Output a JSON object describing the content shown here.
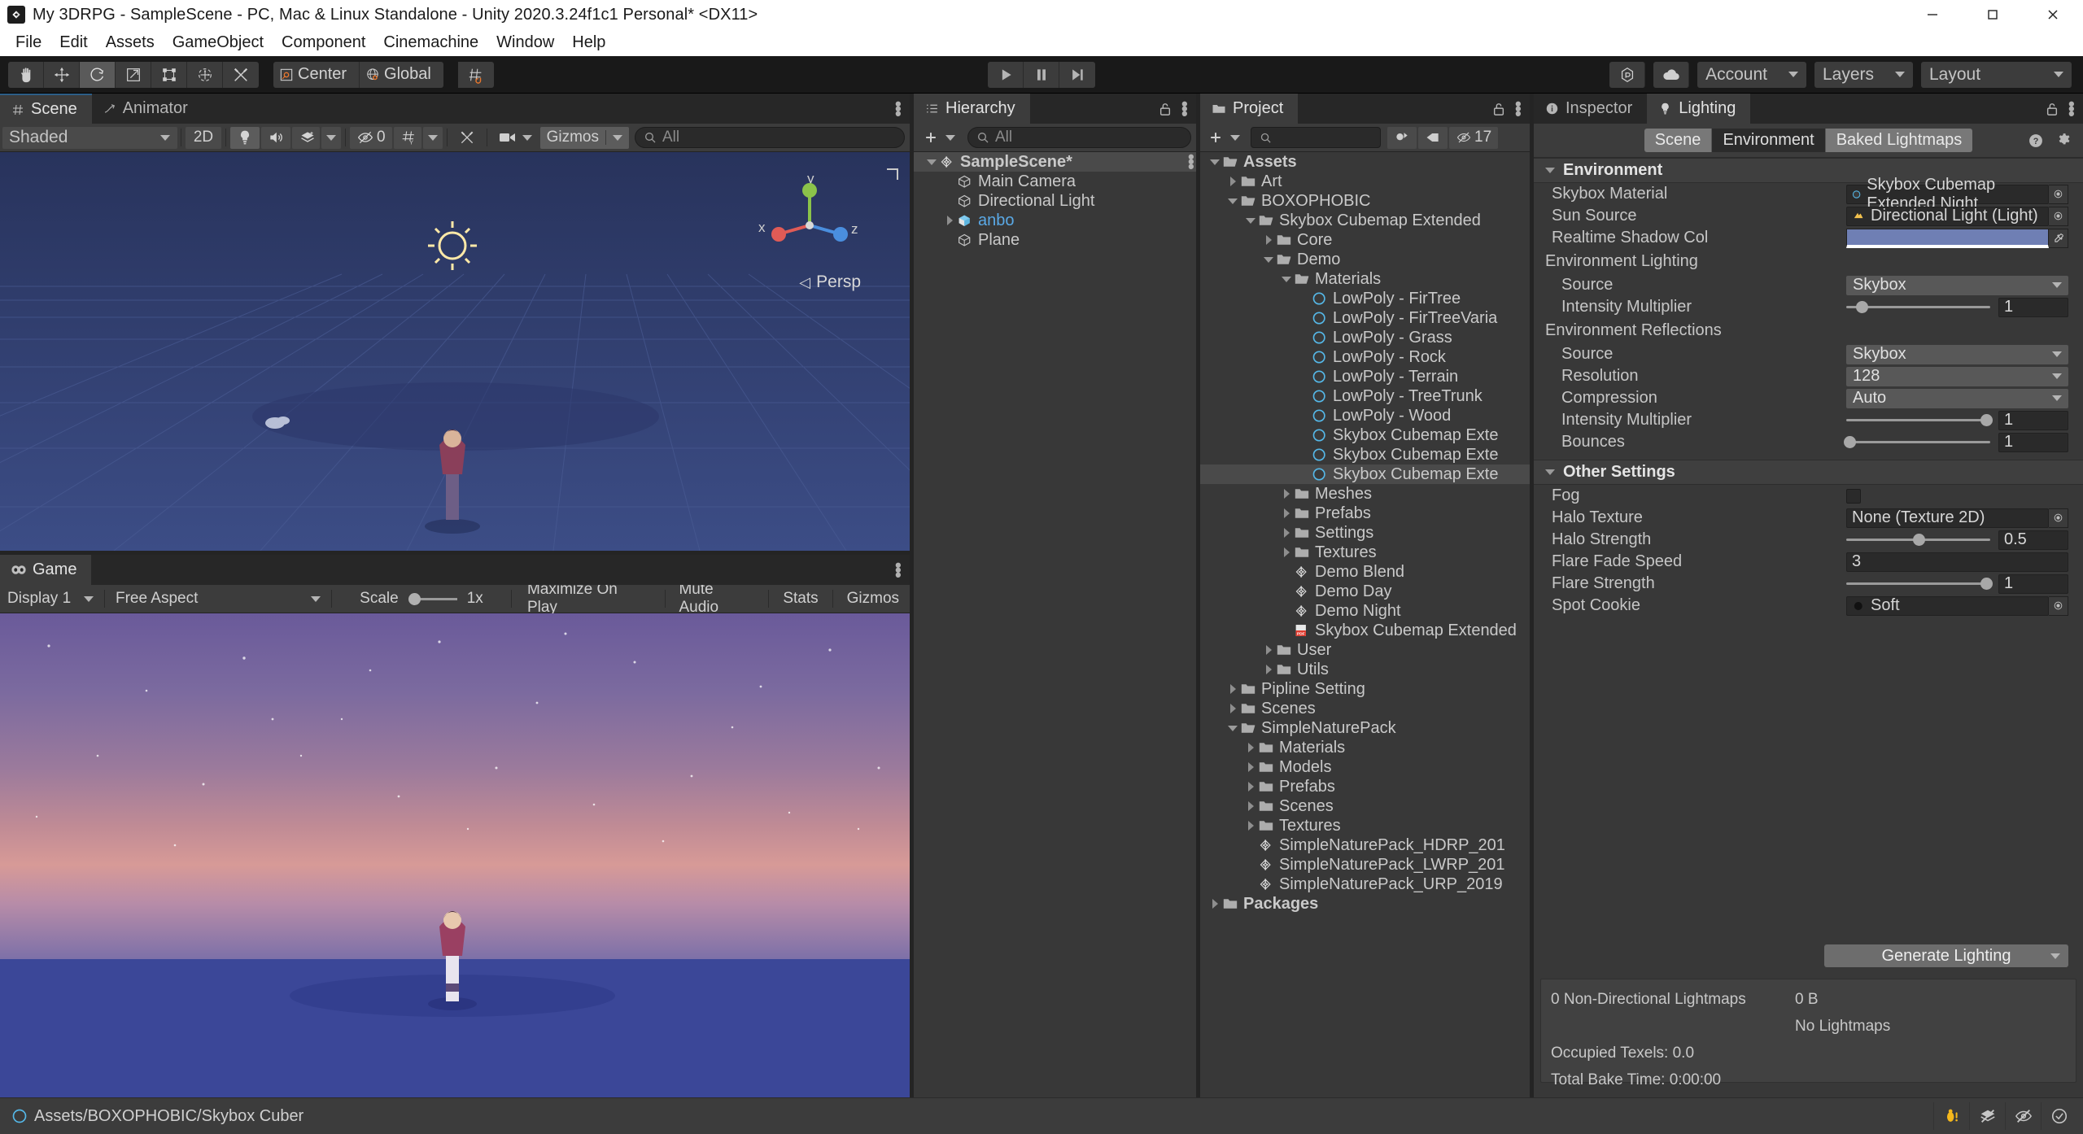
{
  "window": {
    "title": "My 3DRPG - SampleScene - PC, Mac & Linux Standalone - Unity 2020.3.24f1c1 Personal* <DX11>",
    "minimize": "minimize-icon",
    "maximize": "maximize-icon",
    "close": "close-icon"
  },
  "menubar": {
    "items": [
      "File",
      "Edit",
      "Assets",
      "GameObject",
      "Component",
      "Cinemachine",
      "Window",
      "Help"
    ]
  },
  "toolbar": {
    "tools": [
      "hand-tool",
      "move-tool",
      "rotate-tool",
      "scale-tool",
      "rect-tool",
      "transform-tool",
      "custom-tool"
    ],
    "active_tool": "rotate-tool",
    "pivot_mode": "Center",
    "handle_space": "Global",
    "grid_label": "grid-snapping",
    "play": "play-button",
    "pause": "pause-button",
    "step": "step-button",
    "collab": "collab-icon",
    "cloud": "cloud-icon",
    "account": "Account",
    "layers": "Layers",
    "layout": "Layout"
  },
  "scene_panel": {
    "tabs": [
      {
        "label": "Scene",
        "icon": "grid-icon",
        "active": true
      },
      {
        "label": "Animator",
        "icon": "animator-icon",
        "active": false
      }
    ],
    "shading": "Shaded",
    "mode_2d": "2D",
    "lighting_toggle": "scene-lighting-icon",
    "audio_toggle": "scene-audio-icon",
    "fx_toggle": "scene-fx-icon",
    "hidden_count": "0",
    "grid_visibility": "grid-visibility-icon",
    "component_tools": "scene-tools-icon",
    "camera_menu": "scene-camera-icon",
    "gizmos": "Gizmos",
    "search_placeholder": "All",
    "gizmo_axes": {
      "x": "x",
      "y": "y",
      "z": "z"
    },
    "projection": "Persp"
  },
  "game_panel": {
    "tab": "Game",
    "display": "Display 1",
    "aspect": "Free Aspect",
    "scale_label": "Scale",
    "scale_value": "1x",
    "maximize": "Maximize On Play",
    "mute": "Mute Audio",
    "stats": "Stats",
    "gizmos": "Gizmos"
  },
  "hierarchy": {
    "tab": "Hierarchy",
    "lock": "lock-icon",
    "menu": "kebab-menu-icon",
    "add_label": "add-button",
    "search_placeholder": "All",
    "items": [
      {
        "label": "SampleScene*",
        "depth": 0,
        "icon": "unity-scene-icon",
        "twisty": "open",
        "selected": true,
        "bold": true
      },
      {
        "label": "Main Camera",
        "depth": 1,
        "icon": "gameobject-icon",
        "twisty": "none"
      },
      {
        "label": "Directional Light",
        "depth": 1,
        "icon": "gameobject-icon",
        "twisty": "none"
      },
      {
        "label": "anbo",
        "depth": 1,
        "icon": "prefab-icon",
        "twisty": "closed",
        "prefab": true
      },
      {
        "label": "Plane",
        "depth": 1,
        "icon": "gameobject-icon",
        "twisty": "none"
      }
    ]
  },
  "project": {
    "tab": "Project",
    "lock": "lock-icon",
    "menu": "kebab-menu-icon",
    "search_placeholder": "",
    "save_filter": "save-search-icon",
    "label_filter": "label-icon",
    "hidden_icon": "hidden-packages-icon",
    "hidden_count": "17",
    "items": [
      {
        "label": "Assets",
        "depth": 0,
        "icon": "folder-open",
        "twisty": "open",
        "bold": true
      },
      {
        "label": "Art",
        "depth": 1,
        "icon": "folder",
        "twisty": "closed"
      },
      {
        "label": "BOXOPHOBIC",
        "depth": 1,
        "icon": "folder-open",
        "twisty": "open"
      },
      {
        "label": "Skybox Cubemap Extended",
        "depth": 2,
        "icon": "folder-open",
        "twisty": "open"
      },
      {
        "label": "Core",
        "depth": 3,
        "icon": "folder",
        "twisty": "closed"
      },
      {
        "label": "Demo",
        "depth": 3,
        "icon": "folder-open",
        "twisty": "open"
      },
      {
        "label": "Materials",
        "depth": 4,
        "icon": "folder-open",
        "twisty": "open"
      },
      {
        "label": "LowPoly - FirTree",
        "depth": 5,
        "icon": "material-icon",
        "twisty": "none"
      },
      {
        "label": "LowPoly - FirTreeVaria",
        "depth": 5,
        "icon": "material-icon",
        "twisty": "none"
      },
      {
        "label": "LowPoly - Grass",
        "depth": 5,
        "icon": "material-icon",
        "twisty": "none"
      },
      {
        "label": "LowPoly - Rock",
        "depth": 5,
        "icon": "material-icon",
        "twisty": "none"
      },
      {
        "label": "LowPoly - Terrain",
        "depth": 5,
        "icon": "material-icon",
        "twisty": "none"
      },
      {
        "label": "LowPoly - TreeTrunk",
        "depth": 5,
        "icon": "material-icon",
        "twisty": "none"
      },
      {
        "label": "LowPoly - Wood",
        "depth": 5,
        "icon": "material-icon",
        "twisty": "none"
      },
      {
        "label": "Skybox Cubemap Exte",
        "depth": 5,
        "icon": "material-icon",
        "twisty": "none"
      },
      {
        "label": "Skybox Cubemap Exte",
        "depth": 5,
        "icon": "material-icon",
        "twisty": "none"
      },
      {
        "label": "Skybox Cubemap Exte",
        "depth": 5,
        "icon": "material-icon",
        "twisty": "none",
        "selected": true
      },
      {
        "label": "Meshes",
        "depth": 4,
        "icon": "folder",
        "twisty": "closed"
      },
      {
        "label": "Prefabs",
        "depth": 4,
        "icon": "folder",
        "twisty": "closed"
      },
      {
        "label": "Settings",
        "depth": 4,
        "icon": "folder",
        "twisty": "closed"
      },
      {
        "label": "Textures",
        "depth": 4,
        "icon": "folder",
        "twisty": "closed"
      },
      {
        "label": "Demo Blend",
        "depth": 4,
        "icon": "unity-scene-icon",
        "twisty": "none"
      },
      {
        "label": "Demo Day",
        "depth": 4,
        "icon": "unity-scene-icon",
        "twisty": "none"
      },
      {
        "label": "Demo Night",
        "depth": 4,
        "icon": "unity-scene-icon",
        "twisty": "none"
      },
      {
        "label": "Skybox Cubemap Extended",
        "depth": 4,
        "icon": "pdf-icon",
        "twisty": "none"
      },
      {
        "label": "User",
        "depth": 3,
        "icon": "folder",
        "twisty": "closed"
      },
      {
        "label": "Utils",
        "depth": 3,
        "icon": "folder",
        "twisty": "closed"
      },
      {
        "label": "Pipline Setting",
        "depth": 1,
        "icon": "folder",
        "twisty": "closed"
      },
      {
        "label": "Scenes",
        "depth": 1,
        "icon": "folder",
        "twisty": "closed"
      },
      {
        "label": "SimpleNaturePack",
        "depth": 1,
        "icon": "folder-open",
        "twisty": "open"
      },
      {
        "label": "Materials",
        "depth": 2,
        "icon": "folder",
        "twisty": "closed"
      },
      {
        "label": "Models",
        "depth": 2,
        "icon": "folder",
        "twisty": "closed"
      },
      {
        "label": "Prefabs",
        "depth": 2,
        "icon": "folder",
        "twisty": "closed"
      },
      {
        "label": "Scenes",
        "depth": 2,
        "icon": "folder",
        "twisty": "closed"
      },
      {
        "label": "Textures",
        "depth": 2,
        "icon": "folder",
        "twisty": "closed"
      },
      {
        "label": "SimpleNaturePack_HDRP_201",
        "depth": 2,
        "icon": "unity-scene-icon",
        "twisty": "none"
      },
      {
        "label": "SimpleNaturePack_LWRP_201",
        "depth": 2,
        "icon": "unity-scene-icon",
        "twisty": "none"
      },
      {
        "label": "SimpleNaturePack_URP_2019",
        "depth": 2,
        "icon": "unity-scene-icon",
        "twisty": "none"
      },
      {
        "label": "Packages",
        "depth": 0,
        "icon": "folder",
        "twisty": "closed",
        "bold": true
      }
    ]
  },
  "inspector": {
    "tabs": [
      {
        "label": "Inspector",
        "icon": "info-icon",
        "active": false
      },
      {
        "label": "Lighting",
        "icon": "light-bulb-icon",
        "active": true
      }
    ],
    "lock": "lock-icon",
    "menu": "kebab-menu-icon",
    "modes": [
      {
        "label": "Scene",
        "active": false
      },
      {
        "label": "Environment",
        "active": true
      },
      {
        "label": "Baked Lightmaps",
        "active": false
      }
    ],
    "help": "help-icon",
    "settings": "gear-icon",
    "sections": [
      {
        "title": "Environment",
        "rows": [
          {
            "label": "Skybox Material",
            "type": "object",
            "value": "Skybox Cubemap Extended Night",
            "icon": "material-icon"
          },
          {
            "label": "Sun Source",
            "type": "object",
            "value": "Directional Light (Light)",
            "icon": "light-icon"
          },
          {
            "label": "Realtime Shadow Col",
            "type": "color",
            "color": "#6f7fb4",
            "picker": "eyedropper-icon"
          },
          {
            "label": "Environment Lighting",
            "type": "header"
          },
          {
            "label": "Source",
            "type": "dropdown",
            "value": "Skybox",
            "indent": true
          },
          {
            "label": "Intensity Multiplier",
            "type": "slider",
            "value": "1",
            "pct": 11,
            "indent": true
          },
          {
            "label": "Environment Reflections",
            "type": "header"
          },
          {
            "label": "Source",
            "type": "dropdown",
            "value": "Skybox",
            "indent": true
          },
          {
            "label": "Resolution",
            "type": "dropdown",
            "value": "128",
            "indent": true
          },
          {
            "label": "Compression",
            "type": "dropdown",
            "value": "Auto",
            "indent": true
          },
          {
            "label": "Intensity Multiplier",
            "type": "slider",
            "value": "1",
            "pct": 97,
            "indent": true
          },
          {
            "label": "Bounces",
            "type": "slider",
            "value": "1",
            "pct": 2,
            "indent": true
          }
        ]
      },
      {
        "title": "Other Settings",
        "rows": [
          {
            "label": "Fog",
            "type": "checkbox",
            "checked": false
          },
          {
            "label": "Halo Texture",
            "type": "object",
            "value": "None (Texture 2D)"
          },
          {
            "label": "Halo Strength",
            "type": "slider",
            "value": "0.5",
            "pct": 50
          },
          {
            "label": "Flare Fade Speed",
            "type": "text",
            "value": "3"
          },
          {
            "label": "Flare Strength",
            "type": "slider",
            "value": "1",
            "pct": 97
          },
          {
            "label": "Spot Cookie",
            "type": "object",
            "value": "Soft",
            "icon": "texture-icon"
          }
        ]
      }
    ],
    "generate_button": "Generate Lighting",
    "stats": {
      "lightmaps": "0 Non-Directional Lightmaps",
      "size": "0 B",
      "no_lightmaps": "No Lightmaps",
      "occupied": "Occupied Texels: 0.0",
      "bake_time": "Total Bake Time: 0:00:00"
    }
  },
  "statusbar": {
    "path": "Assets/BOXOPHOBIC/Skybox Cuber",
    "path_icon": "material-icon",
    "icons": [
      "bug-warning-icon",
      "layers-off-icon",
      "eye-off-icon",
      "check-circle-icon"
    ]
  },
  "colors": {
    "accent_blue": "#2c5d87",
    "panel_bg": "#383838",
    "toolbar_bg": "#3c3c3c",
    "dark_bg": "#272727",
    "shadow_color": "#6f7fb4",
    "highlight_orange": "#e8772e"
  }
}
